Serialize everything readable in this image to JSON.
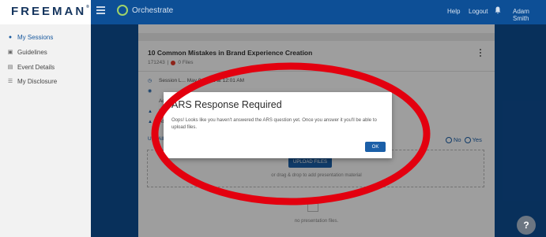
{
  "brand": {
    "logo": "FREEMAN",
    "app_title": "Orchestrate"
  },
  "header": {
    "help_label": "Help",
    "logout_label": "Logout",
    "user_name": "Adam Smith"
  },
  "sidebar": {
    "items": [
      {
        "label": "My Sessions",
        "icon": "users-icon",
        "active": true
      },
      {
        "label": "Guidelines",
        "icon": "book-icon",
        "active": false
      },
      {
        "label": "Event Details",
        "icon": "calendar-icon",
        "active": false
      },
      {
        "label": "My Disclosure",
        "icon": "list-icon",
        "active": false
      }
    ]
  },
  "session": {
    "title": "10 Common Mistakes in Brand Experience Creation",
    "id": "171243",
    "files": "0 Files",
    "details": [
      {
        "icon": "clock-icon",
        "text": "Session L...  May 9, 2021 at 12:01 AM"
      },
      {
        "icon": "pin-icon",
        "text": ""
      },
      {
        "icon": "",
        "text": "Ad..."
      },
      {
        "icon": "person-icon",
        "text": "Pre..."
      },
      {
        "icon": "group-icon",
        "text": "Att..."
      }
    ],
    "link_text": "Use All...",
    "radio_no": "No",
    "radio_yes": "Yes",
    "upload_button": "UPLOAD FILES",
    "upload_hint": "or drag & drop to add presentation material",
    "empty_text": "no presentation files."
  },
  "modal": {
    "title": "ARS Response Required",
    "body": "Oops! Looks like you haven't answered the ARS question yet. Once you answer it you'll be able to upload files.",
    "ok_label": "OK"
  },
  "help_fab": "?",
  "colors": {
    "header": "#0d4f96",
    "accent": "#1b5fa8",
    "annotation": "#e3000f",
    "status_dot": "#e53b2a"
  }
}
